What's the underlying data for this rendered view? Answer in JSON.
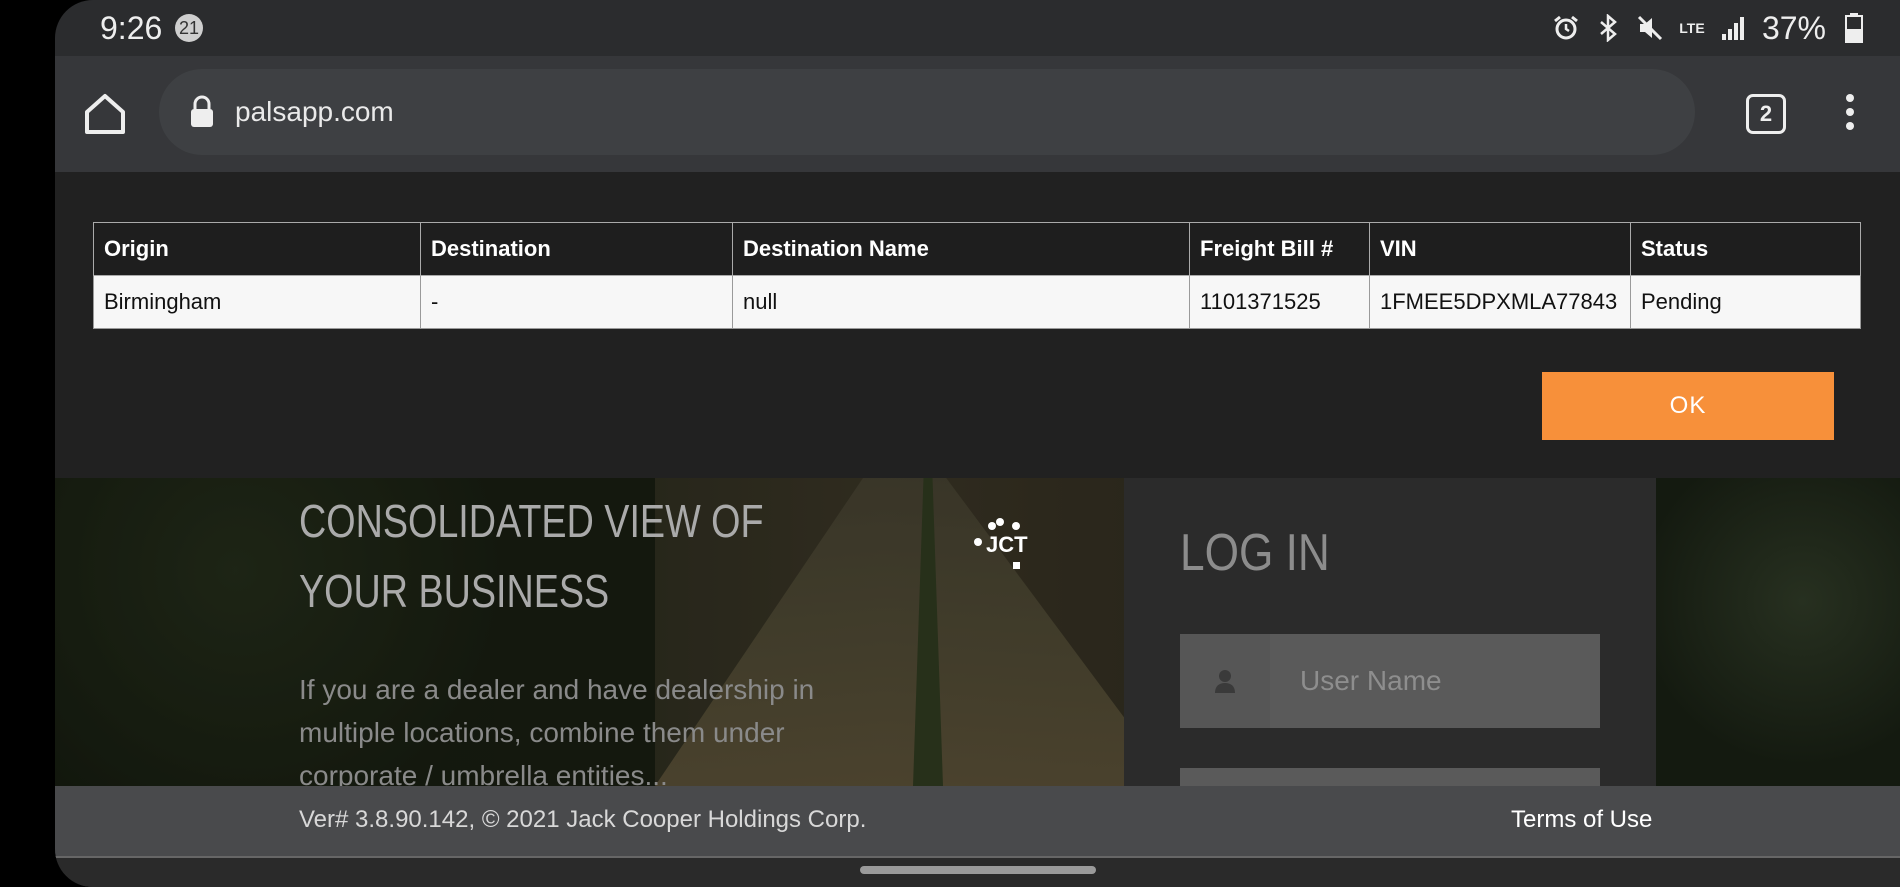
{
  "status_bar": {
    "time": "9:26",
    "notification_count": "21",
    "network": "LTE",
    "battery": "37%"
  },
  "browser": {
    "url": "palsapp.com",
    "tab_count": "2"
  },
  "results_table": {
    "headers": [
      "Origin",
      "Destination",
      "Destination Name",
      "Freight Bill #",
      "VIN",
      "Status"
    ],
    "rows": [
      [
        "Birmingham",
        "-",
        "null",
        "1101371525",
        "1FMEE5DPXMLA77843",
        "Pending"
      ]
    ]
  },
  "dialog": {
    "ok_label": "OK"
  },
  "hero": {
    "title": "CONSOLIDATED VIEW OF YOUR BUSINESS",
    "text": "If you are a dealer and have dealership in multiple locations, combine them under corporate / umbrella entities...",
    "logo_text": "JCT"
  },
  "login": {
    "title": "LOG IN",
    "username_placeholder": "User Name"
  },
  "footer": {
    "version": "Ver# 3.8.90.142, © 2021 Jack Cooper Holdings Corp.",
    "terms": "Terms of Use"
  },
  "colors": {
    "accent": "#f7903a",
    "page_bg": "#212121",
    "browser_bar": "#36373a"
  }
}
